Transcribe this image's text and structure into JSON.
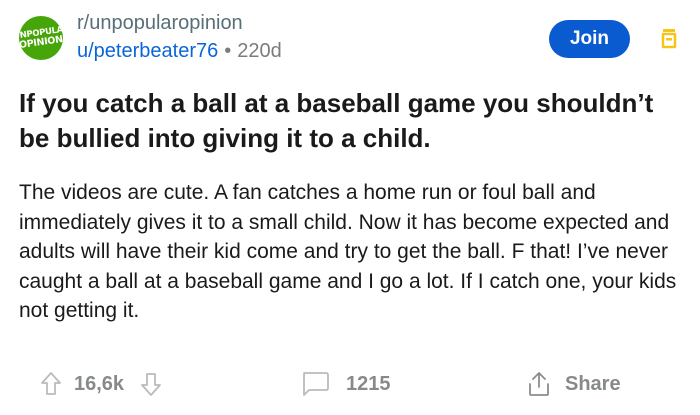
{
  "subreddit": {
    "name": "r/unpopularopinion",
    "logo_text_line1": "UNPOPULAR",
    "logo_text_line2": "OPINION",
    "logo_color": "#46a508"
  },
  "post": {
    "author": "u/peterbeater76",
    "separator": "•",
    "age": "220d",
    "title": "If you catch a ball at a baseball game you shouldn’t be bullied into giving it to a child.",
    "body": "The videos are cute. A fan catches a home run or foul ball and immediately gives it to a small child. Now it has become expected and adults will have their kid come and try to get the ball. F that! I’ve never caught a ball at a baseball game and I go a lot. If I catch one, your kids not getting it."
  },
  "actions": {
    "join_label": "Join",
    "save_icon": "save-icon",
    "vote_count": "16,6k",
    "comment_count": "1215",
    "share_label": "Share"
  },
  "colors": {
    "join_button": "#0a5bd0",
    "username": "#0a66d8",
    "save_icon": "#f5c518",
    "muted": "#878a8c"
  }
}
